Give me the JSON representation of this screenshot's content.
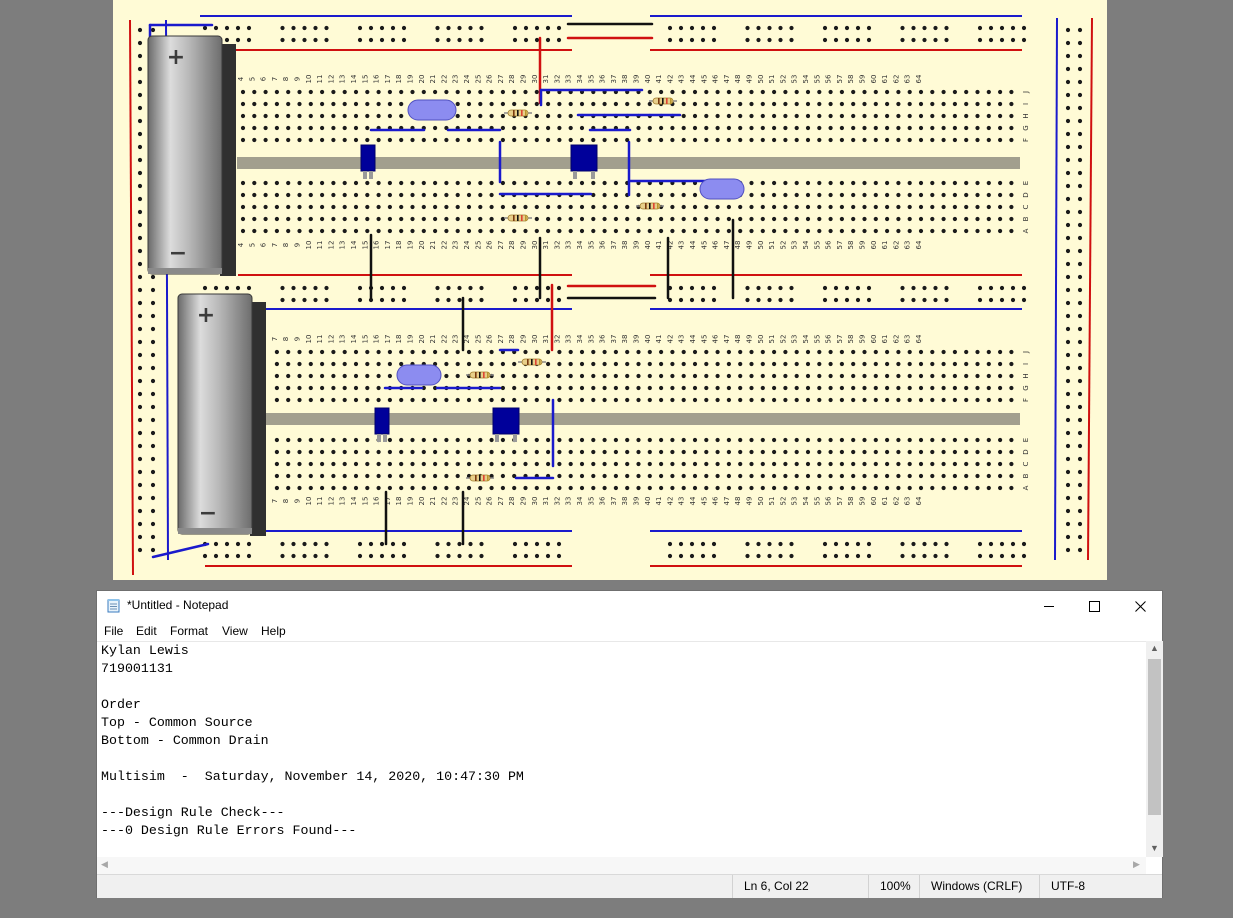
{
  "window": {
    "title": "*Untitled - Notepad",
    "icon": "notepad-icon",
    "controls": {
      "minimize": "minimize-icon",
      "maximize": "maximize-icon",
      "close": "close-icon"
    }
  },
  "menu": {
    "file": "File",
    "edit": "Edit",
    "format": "Format",
    "view": "View",
    "help": "Help"
  },
  "editor": {
    "lines": [
      "Kylan Lewis",
      "719001131",
      "",
      "Order",
      "Top - Common Source",
      "Bottom - Common Drain",
      "",
      "Multisim  -  Saturday, November 14, 2020, 10:47:30 PM",
      "",
      "---Design Rule Check---",
      "---0 Design Rule Errors Found---"
    ]
  },
  "status": {
    "position": "Ln 6, Col 22",
    "zoom": "100%",
    "line_ending": "Windows (CRLF)",
    "encoding": "UTF-8"
  },
  "breadboard": {
    "row_letters": [
      "J",
      "I",
      "H",
      "G",
      "F",
      "E",
      "D",
      "C",
      "B",
      "A"
    ],
    "col_start": 4,
    "col_end": 64,
    "battery_plus": "+",
    "battery_minus": "−"
  },
  "colors": {
    "desktop": "#7d7d7d",
    "board": "#fffbd6",
    "wire_red": "#d01010",
    "wire_blue": "#1a1acc",
    "wire_black": "#111111",
    "chip": "#00009a",
    "capacitor": "#8c8cf0"
  }
}
